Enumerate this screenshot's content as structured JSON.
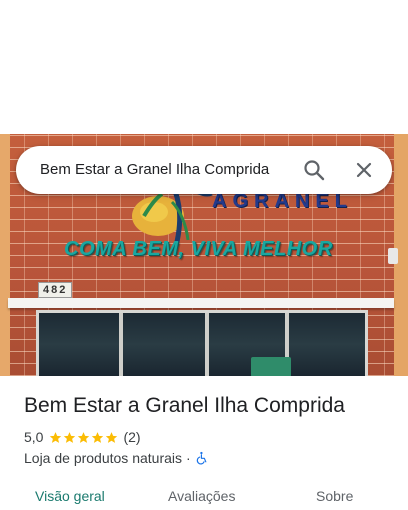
{
  "search": {
    "query": "Bem Estar a Granel Ilha Comprida"
  },
  "photo": {
    "sign_brand": "AGRANEL",
    "slogan": "COMA BEM, VIVA MELHOR",
    "house_number": "482"
  },
  "place": {
    "name": "Bem Estar a Granel Ilha Comprida",
    "rating": "5,0",
    "stars": 5,
    "review_count": "(2)",
    "category": "Loja de produtos naturais",
    "separator": "·",
    "accessibility_icon": "wheelchair-icon"
  },
  "tabs": [
    {
      "label": "Visão geral",
      "active": true
    },
    {
      "label": "Avaliações",
      "active": false
    },
    {
      "label": "Sobre",
      "active": false
    }
  ],
  "colors": {
    "accent": "#1a7a6e",
    "star": "#fbbc04",
    "access_icon": "#1a73e8"
  }
}
